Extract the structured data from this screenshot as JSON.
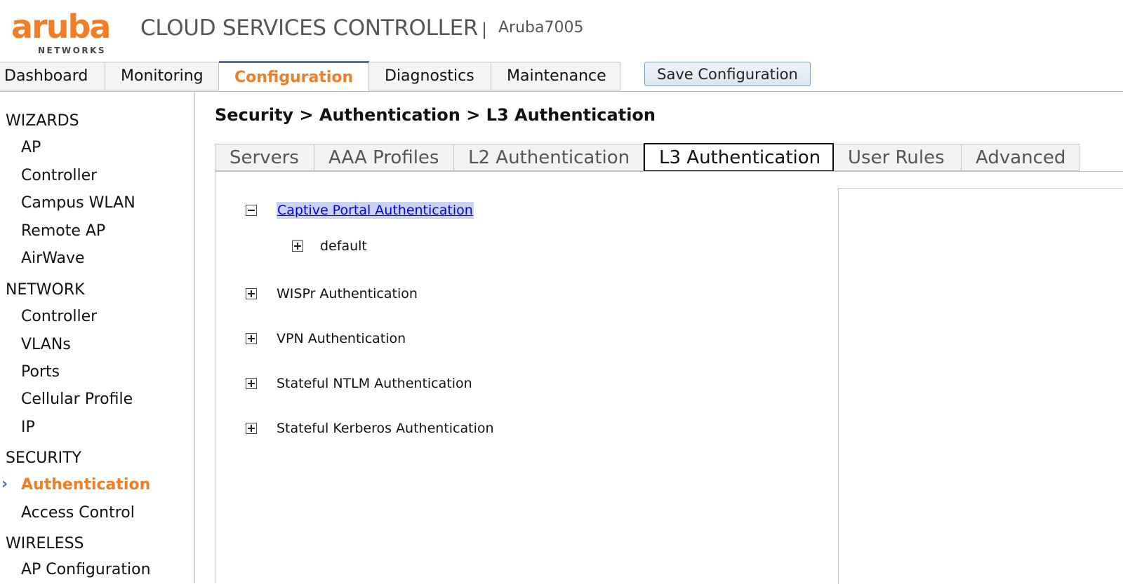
{
  "brand": {
    "logo_text": "aruba",
    "logo_subtext": "NETWORKS",
    "product_title": "CLOUD SERVICES CONTROLLER",
    "separator": "|",
    "device_name": "Aruba7005",
    "colors": {
      "accent": "#f07e26",
      "tab_border": "#4a6fa5",
      "link": "#0000ee"
    }
  },
  "topnav": {
    "tabs": [
      {
        "label": "Dashboard"
      },
      {
        "label": "Monitoring"
      },
      {
        "label": "Configuration",
        "active": true
      },
      {
        "label": "Diagnostics"
      },
      {
        "label": "Maintenance"
      }
    ],
    "save_label": "Save Configuration"
  },
  "sidebar": {
    "sections": [
      {
        "title": "WIZARDS",
        "items": [
          "AP",
          "Controller",
          "Campus WLAN",
          "Remote AP",
          "AirWave"
        ]
      },
      {
        "title": "NETWORK",
        "items": [
          "Controller",
          "VLANs",
          "Ports",
          "Cellular Profile",
          "IP"
        ]
      },
      {
        "title": "SECURITY",
        "items": [
          "Authentication",
          "Access Control"
        ],
        "active_item": "Authentication",
        "active_marker": "›"
      },
      {
        "title": "WIRELESS",
        "items": [
          "AP Configuration"
        ]
      }
    ]
  },
  "main": {
    "breadcrumb": "Security > Authentication > L3 Authentication",
    "tabs": [
      {
        "label": "Servers"
      },
      {
        "label": "AAA Profiles"
      },
      {
        "label": "L2 Authentication"
      },
      {
        "label": "L3 Authentication",
        "active": true
      },
      {
        "label": "User Rules"
      },
      {
        "label": "Advanced"
      }
    ],
    "tree": [
      {
        "label": "Captive Portal Authentication",
        "expanded": true,
        "selected": true,
        "children": [
          {
            "label": "default",
            "expanded": false
          }
        ]
      },
      {
        "label": "WISPr Authentication",
        "expanded": false
      },
      {
        "label": "VPN Authentication",
        "expanded": false
      },
      {
        "label": "Stateful NTLM Authentication",
        "expanded": false
      },
      {
        "label": "Stateful Kerberos Authentication",
        "expanded": false
      }
    ]
  }
}
